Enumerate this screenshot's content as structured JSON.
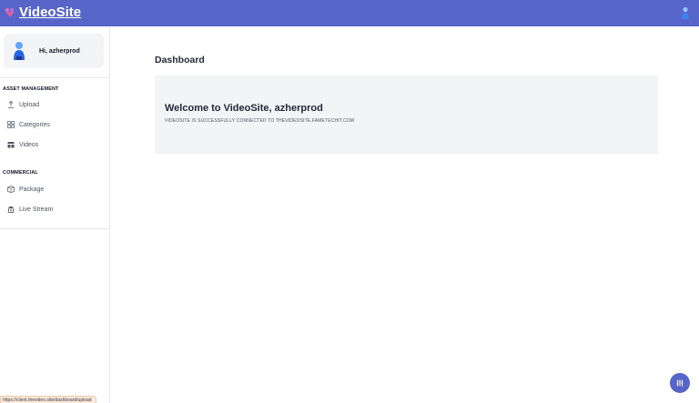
{
  "app": {
    "brand_name": "VideoSite",
    "brand_color": "#5764c8",
    "logo_icon": "heart-logo-icon",
    "profile_icon": "user-avatar-icon"
  },
  "sidebar": {
    "greeting": "Hi, azherprod",
    "sections": [
      {
        "title": "ASSET MANAGEMENT",
        "items": [
          {
            "label": "Upload",
            "icon": "upload-icon"
          },
          {
            "label": "Categories",
            "icon": "grid-icon"
          },
          {
            "label": "Videos",
            "icon": "video-list-icon"
          }
        ]
      },
      {
        "title": "COMMERCIAL",
        "items": [
          {
            "label": "Package",
            "icon": "box-icon"
          },
          {
            "label": "Live Stream",
            "icon": "building-icon"
          }
        ]
      }
    ]
  },
  "main": {
    "page_title": "Dashboard",
    "welcome_title": "Welcome to VideoSite, azherprod",
    "welcome_subtitle": "VIDEOSITE IS SUCCESSFULLY CONNECTED TO THEVIDEOSITE.FAMETECHIT.COM"
  },
  "status_bar": {
    "url": "https://client.thevideo.site/dashboard/upload"
  },
  "fab": {
    "icon": "sliders-icon"
  }
}
